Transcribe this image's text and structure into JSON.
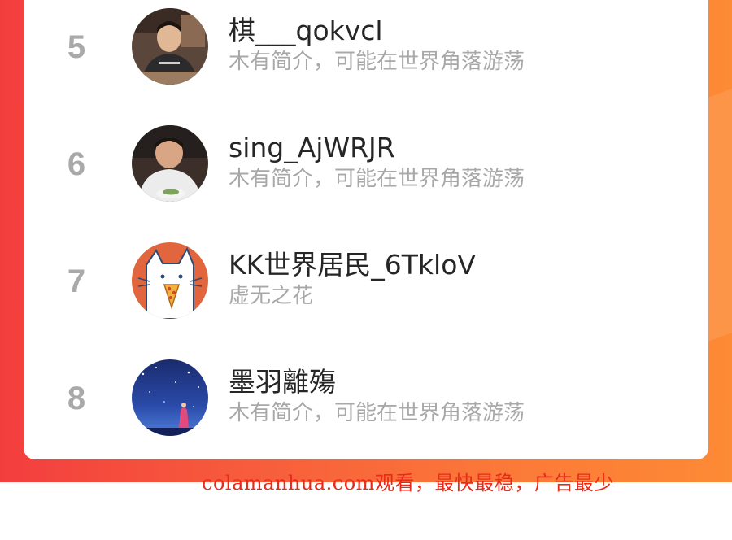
{
  "ranking": {
    "items": [
      {
        "rank": "5",
        "name": "棋___qokvcl",
        "bio": "木有简介，可能在世界角落游荡",
        "avatar": "person-dining-photo"
      },
      {
        "rank": "6",
        "name": "sing_AjWRJR",
        "bio": "木有简介，可能在世界角落游荡",
        "avatar": "person-with-plate-photo"
      },
      {
        "rank": "7",
        "name": "KK世界居民_6TkloV",
        "bio": "虚无之花",
        "avatar": "cat-eating-pizza-illustration"
      },
      {
        "rank": "8",
        "name": "墨羽離殤",
        "bio": "木有简介，可能在世界角落游荡",
        "avatar": "starry-night-figure-illustration"
      }
    ]
  },
  "watermark": "colamanhua.com观看，最快最稳，广告最少",
  "colors": {
    "rank_gray": "#a9a9a9",
    "name_text": "#262626",
    "bio_text": "#a8a8a8",
    "gradient_left": "#f33e3e",
    "gradient_right": "#fd8a35",
    "watermark_red": "#e82a1a"
  }
}
